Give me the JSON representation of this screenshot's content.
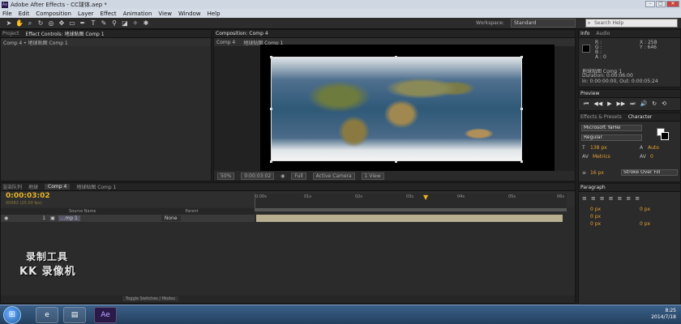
{
  "window": {
    "title": "Adobe After Effects - CC球体.aep *",
    "app_icon": "Ae",
    "controls": [
      "–",
      "□",
      "✕"
    ]
  },
  "menu": [
    "File",
    "Edit",
    "Composition",
    "Layer",
    "Effect",
    "Animation",
    "View",
    "Window",
    "Help"
  ],
  "toolbar": {
    "workspace_label": "Workspace:",
    "workspace_value": "Standard",
    "search_placeholder": "Search Help"
  },
  "left_panel": {
    "tabs": [
      "Project",
      "Effect Controls: 地球贴图 Comp 1"
    ],
    "breadcrumb": "Comp 4 • 地球贴图 Comp 1"
  },
  "viewer": {
    "tabs": [
      "Composition: Comp 4"
    ],
    "subtabs": [
      "Comp 4",
      "地球贴图 Comp 1"
    ],
    "zoom": "50%",
    "timecode": "0:00:03:02",
    "resolution": "Full",
    "camera": "Active Camera",
    "views": "1 View"
  },
  "timeline": {
    "tabs": [
      "渲染队列",
      "地球",
      "Comp 4",
      "地球贴图 Comp 1"
    ],
    "active_tab": "Comp 4",
    "timecode": "0:00:03:02",
    "fps": "00082 (25.00 fps)",
    "ruler_ticks": [
      "0:00s",
      "01s",
      "02s",
      "03s",
      "04s",
      "05s",
      "06s"
    ],
    "column_source_name": "Source Name",
    "column_parent": "Parent",
    "layer": {
      "index": "1",
      "name": "...mp 1",
      "parent": "None"
    },
    "toggle_label": "Toggle Switches / Modes"
  },
  "watermark": {
    "line1": "录制工具",
    "line2": "KK 录像机"
  },
  "info_panel": {
    "tabs": [
      "Info",
      "Audio"
    ],
    "r": "R :",
    "g": "G :",
    "b": "B :",
    "a": "A : 0",
    "x": "X : 258",
    "y": "Y : 646",
    "layer_name": "地球贴图 Comp 1",
    "duration": "Duration: 0:00:06:00",
    "in_out": "In: 0:00:00:00, Out: 0:00:05:24"
  },
  "preview_panel": {
    "tabs": [
      "Preview"
    ],
    "buttons": [
      "⏮",
      "◀◀",
      "▶",
      "▶▶",
      "⏭",
      "🔊",
      "↻",
      "⟲"
    ]
  },
  "character_panel": {
    "tabs": [
      "Effects & Presets",
      "Character"
    ],
    "font": "Microsoft YaHei",
    "style": "Regular",
    "size": "138 px",
    "leading": "Auto",
    "kerning": "Metrics",
    "tracking": "0",
    "stroke_size": "16 px",
    "stroke_mode": "Stroke Over Fill"
  },
  "paragraph_panel": {
    "tabs": [
      "Paragraph"
    ],
    "indents": [
      "0 px",
      "0 px",
      "0 px",
      "0 px",
      "0 px"
    ]
  },
  "taskbar": {
    "time": "8:25",
    "date": "2014/7/18"
  },
  "colors": {
    "timecode": "#e6b422",
    "layer_bar": "#b8ae90",
    "accent": "#e6a030"
  }
}
